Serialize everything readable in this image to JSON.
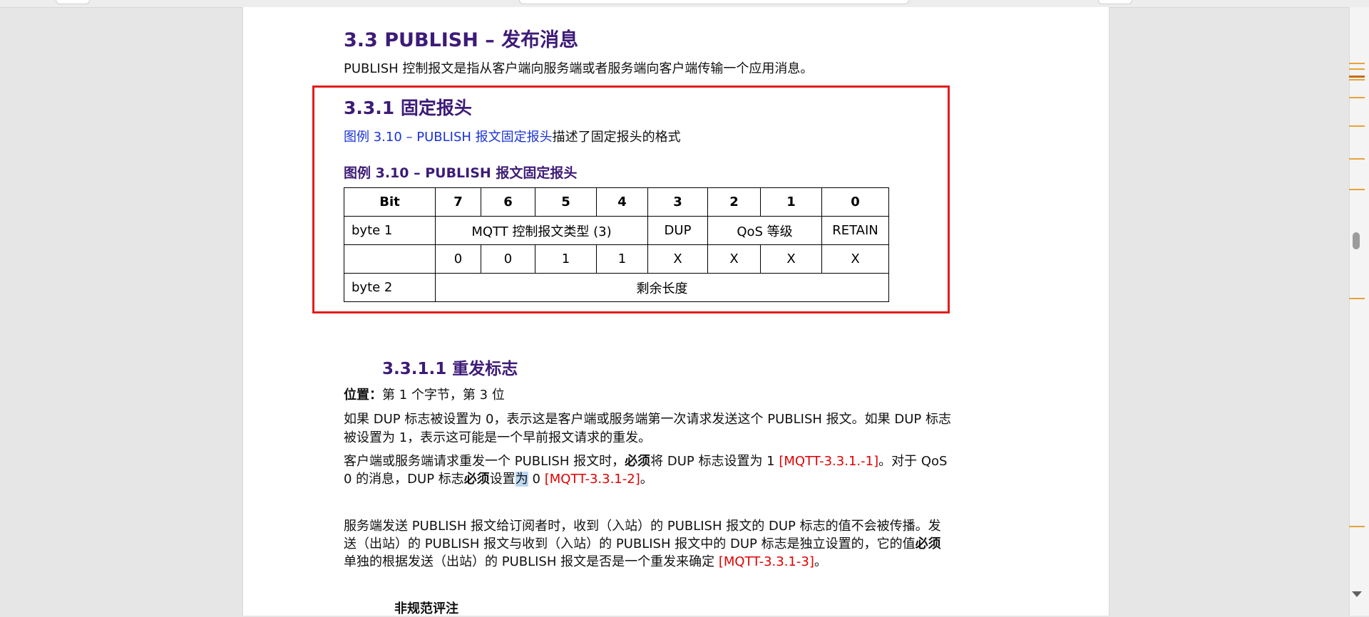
{
  "section": {
    "heading": "3.3 PUBLISH – 发布消息",
    "intro": "PUBLISH 控制报文是指从客户端向服务端或者服务端向客户端传输一个应用消息。"
  },
  "fixed_header": {
    "heading": "3.3.1 固定报头",
    "link_text": "图例 3.10 – PUBLISH 报文固定报头",
    "link_suffix": "描述了固定报头的格式",
    "caption": "图例 3.10 – PUBLISH 报文固定报头",
    "table": {
      "header": [
        "Bit",
        "7",
        "6",
        "5",
        "4",
        "3",
        "2",
        "1",
        "0"
      ],
      "byte1_label": "byte 1",
      "packet_type": "MQTT 控制报文类型 (3)",
      "dup": "DUP",
      "qos": "QoS 等级",
      "retain": "RETAIN",
      "bit_values": [
        "0",
        "0",
        "1",
        "1",
        "X",
        "X",
        "X",
        "X"
      ],
      "byte2_label": "byte 2",
      "remaining_length": "剩余长度"
    }
  },
  "dup_flag": {
    "heading": "3.3.1.1 重发标志",
    "position_label": "位置：",
    "position_text": "第 1 个字节，第 3 位",
    "p1_line1": "如果 DUP 标志被设置为 0，表示这是客户端或服务端第一次请求发送这个 PUBLISH 报文。如果 DUP 标志",
    "p1_line2": "被设置为 1，表示这可能是一个早前报文请求的重发。",
    "p2_line1_a": "客户端或服务端请求重发一个 PUBLISH 报文时，",
    "p2_line1_must": "必须",
    "p2_line1_b": "将 DUP 标志设置为 1 ",
    "p2_ref1": "[MQTT-3.3.1.-1]",
    "p2_line1_c": "。对于 QoS",
    "p2_line2_a": "0 的消息，DUP 标志",
    "p2_line2_must": "必须",
    "p2_line2_b": "设置",
    "p2_line2_hl": "为",
    "p2_line2_c": " 0  ",
    "p2_ref2": "[MQTT-3.3.1-2]",
    "p2_line2_d": "。",
    "p3_line1": "服务端发送 PUBLISH 报文给订阅者时，收到（入站）的 PUBLISH 报文的 DUP 标志的值不会被传播。发",
    "p3_line2_a": "送（出站）的 PUBLISH 报文与收到（入站）的 PUBLISH 报文中的 DUP 标志是独立设置的，它的值",
    "p3_line2_must": "必须",
    "p3_line3_a": "单独的根据发送（出站）的 PUBLISH 报文是否是一个重发来确定  ",
    "p3_ref3": "[MQTT-3.3.1-3]",
    "p3_line3_b": "。",
    "note_heading": "非规范评注"
  }
}
